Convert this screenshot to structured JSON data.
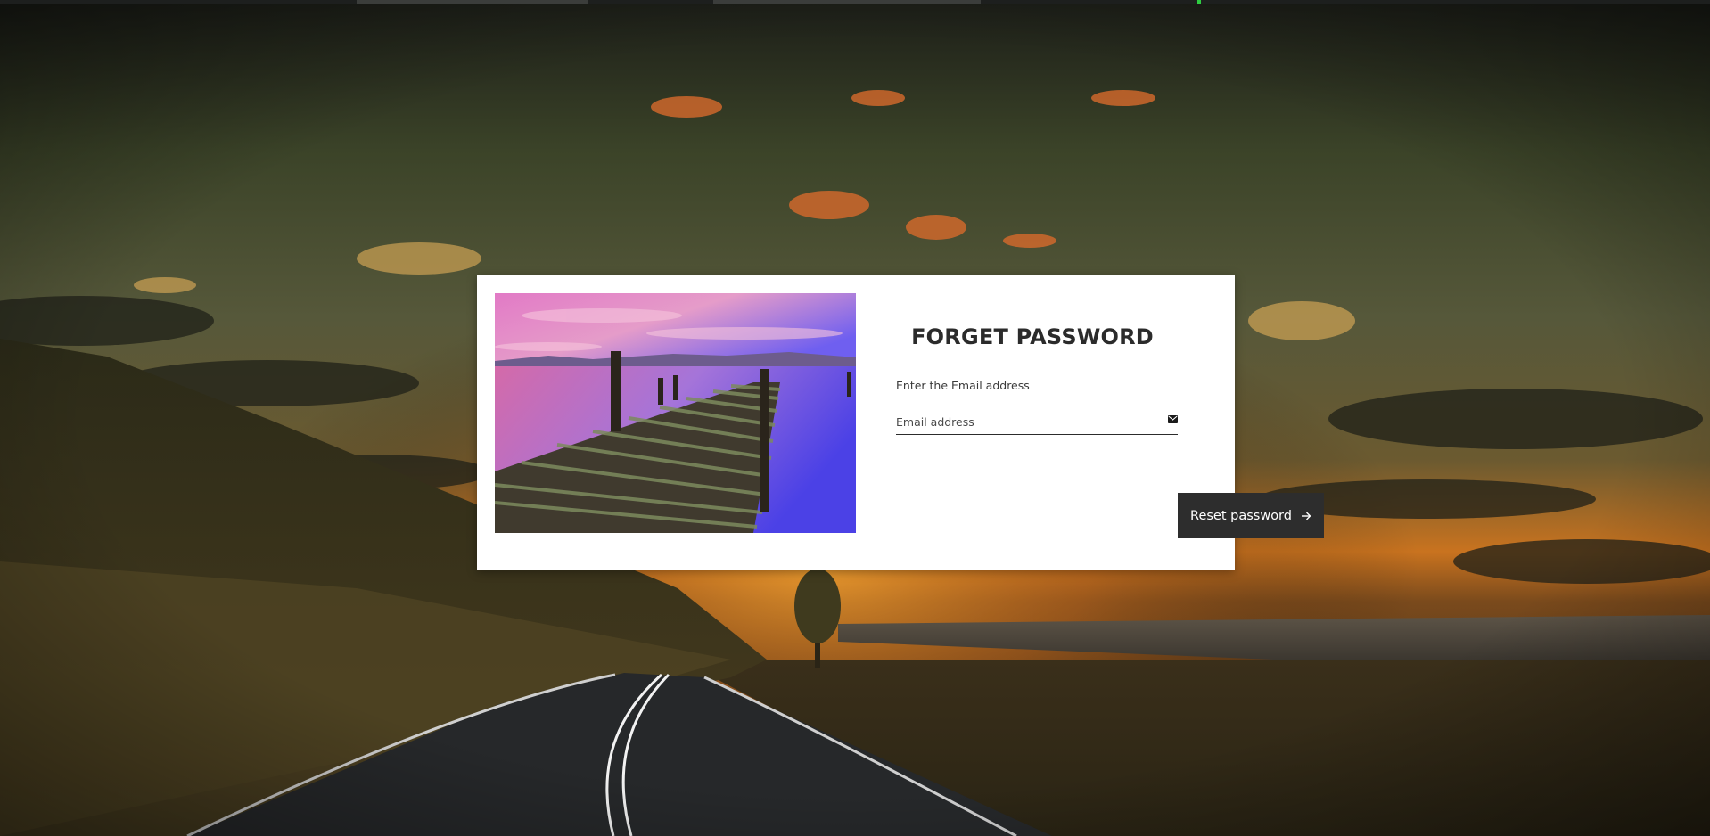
{
  "form": {
    "title": "FORGET PASSWORD",
    "email_label": "Enter the Email address",
    "email_placeholder": "Email address",
    "email_value": "",
    "submit_label": "Reset password"
  },
  "icons": {
    "email_field_icon": "envelope-icon",
    "submit_icon": "arrow-right-icon"
  },
  "colors": {
    "button_background": "#2d2d2d",
    "card_background": "#ffffff",
    "title_text": "#2b2b2b"
  }
}
